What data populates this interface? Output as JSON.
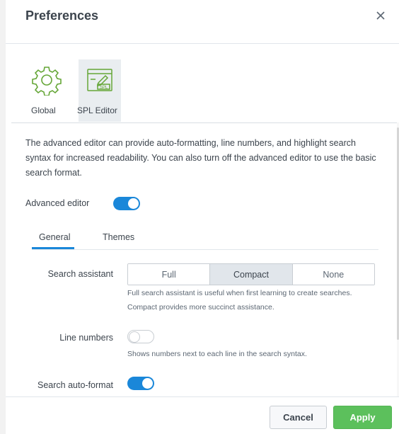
{
  "dialog": {
    "title": "Preferences"
  },
  "categories": [
    {
      "label": "Global",
      "icon": "gear-icon"
    },
    {
      "label": "SPL Editor",
      "icon": "spl-editor-icon",
      "icon_text": "SPL",
      "selected": true
    }
  ],
  "description": "The advanced editor can provide auto-formatting, line numbers, and highlight search syntax for increased readability. You can also turn off the advanced editor to use the basic search format.",
  "advanced_editor": {
    "label": "Advanced editor",
    "enabled": true
  },
  "tabs": [
    {
      "label": "General",
      "active": true
    },
    {
      "label": "Themes",
      "active": false
    }
  ],
  "search_assistant": {
    "label": "Search assistant",
    "options": [
      "Full",
      "Compact",
      "None"
    ],
    "selected": "Compact",
    "help": "Full search assistant is useful when first learning to create searches. Compact provides more succinct assistance."
  },
  "line_numbers": {
    "label": "Line numbers",
    "enabled": false,
    "help": "Shows numbers next to each line in the search syntax."
  },
  "search_auto_format": {
    "label": "Search auto-format",
    "enabled": true
  },
  "footer": {
    "cancel_label": "Cancel",
    "apply_label": "Apply"
  },
  "colors": {
    "accent": "#1a87d9",
    "apply": "#5cc05c",
    "icon_green": "#65a637"
  }
}
